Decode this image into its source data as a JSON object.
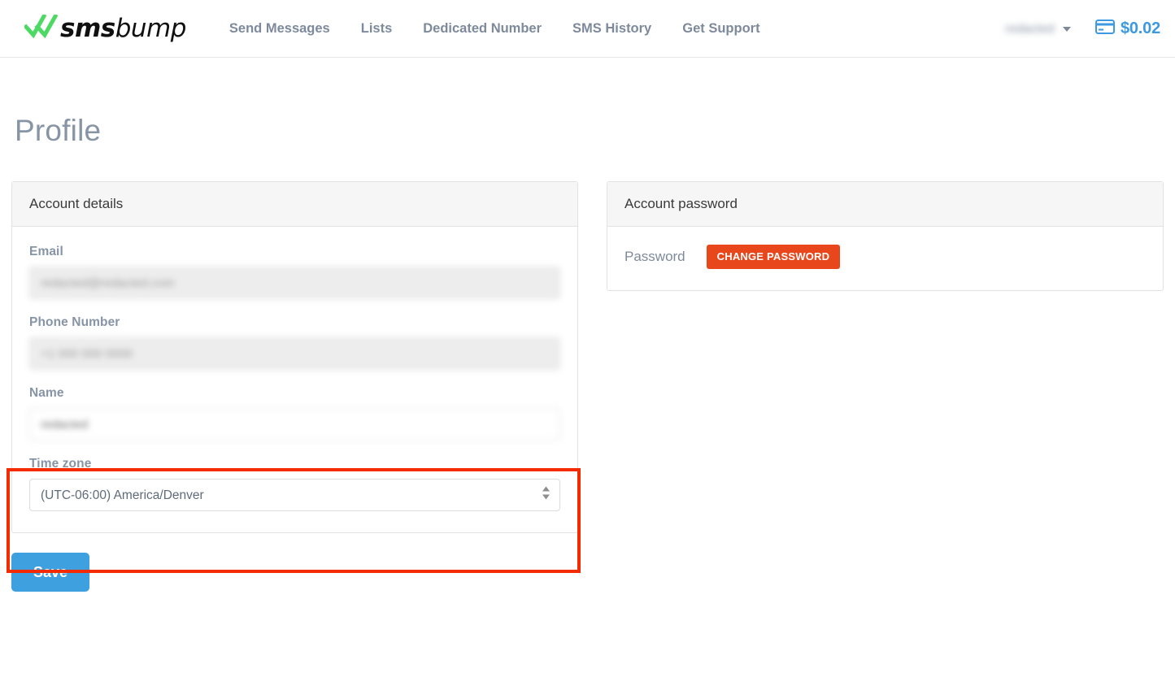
{
  "header": {
    "logo": {
      "text_bold": "sms",
      "text_light": "bump",
      "check_color": "#4cd964"
    },
    "nav": [
      {
        "label": "Send Messages"
      },
      {
        "label": "Lists"
      },
      {
        "label": "Dedicated Number"
      },
      {
        "label": "SMS History"
      },
      {
        "label": "Get Support"
      }
    ],
    "user": {
      "name": "redacted"
    },
    "balance": {
      "amount": "$0.02",
      "icon": "credit-card-icon",
      "color": "#3d9ae0"
    }
  },
  "page": {
    "title": "Profile"
  },
  "account_details": {
    "panel_title": "Account details",
    "fields": {
      "email": {
        "label": "Email",
        "value": "redacted@redacted.com",
        "disabled": true
      },
      "phone": {
        "label": "Phone Number",
        "value": "+1 000 000 0000",
        "disabled": true
      },
      "name": {
        "label": "Name",
        "value": "redacted",
        "disabled": false
      },
      "timezone": {
        "label": "Time zone",
        "value": "(UTC-06:00) America/Denver",
        "options": [
          "(UTC-06:00) America/Denver"
        ]
      }
    }
  },
  "account_password": {
    "panel_title": "Account password",
    "password_label": "Password",
    "change_button": "CHANGE PASSWORD",
    "button_color": "#e8471c"
  },
  "actions": {
    "save_label": "Save",
    "save_color": "#3fa0e0"
  },
  "annotation": {
    "color": "#f42b00",
    "target": "time-zone-field"
  }
}
